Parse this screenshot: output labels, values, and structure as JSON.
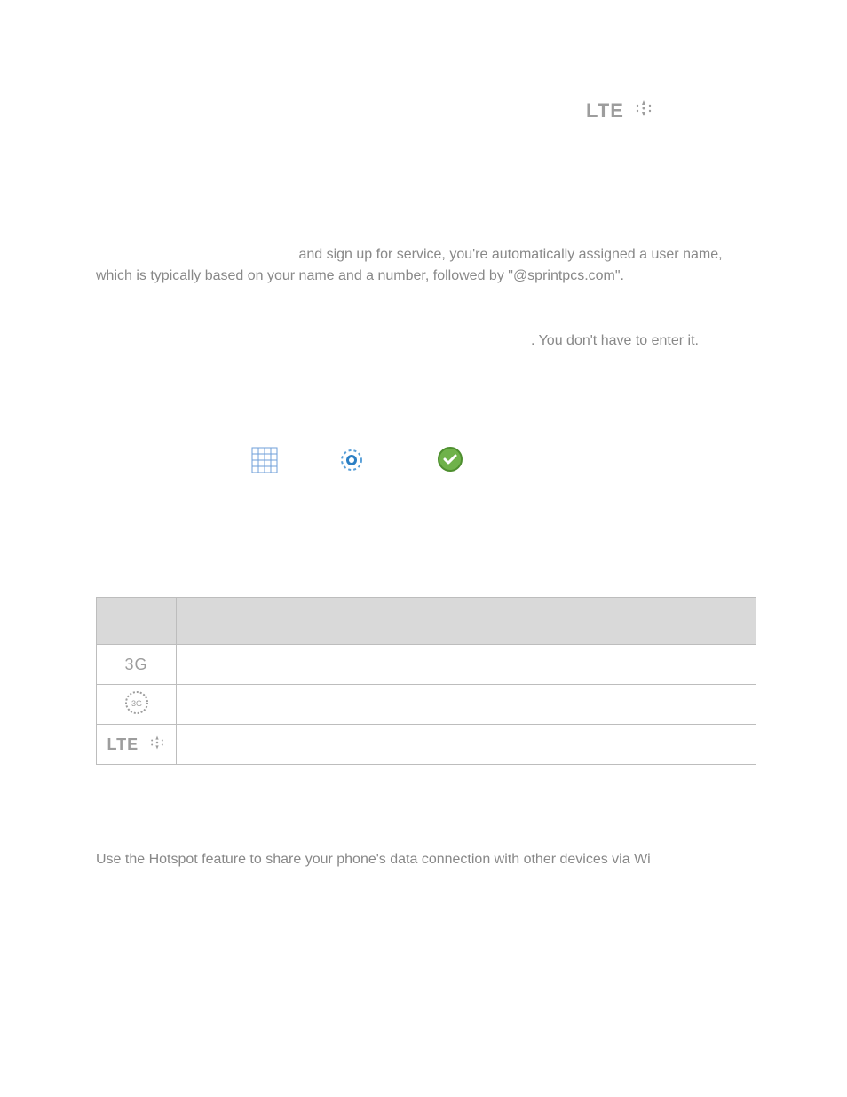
{
  "top_indicator": {
    "label": "LTE"
  },
  "intro": {
    "p1_suffix": " and sign up for service, you're automatically assigned a user name, which is typically based on your name and a number, followed by \"@sprintpcs.com\".",
    "p2_suffix": ". You don't have to enter it."
  },
  "table": {
    "header": {
      "col1": "",
      "col2": ""
    },
    "rows": [
      {
        "icon_label": "3G",
        "desc": ""
      },
      {
        "icon_label": "3G-ring",
        "desc": ""
      },
      {
        "icon_label": "LTE",
        "desc": ""
      }
    ]
  },
  "hotspot": {
    "line1": "Use the Hotspot feature to share your phone's data connection with other devices via Wi"
  }
}
